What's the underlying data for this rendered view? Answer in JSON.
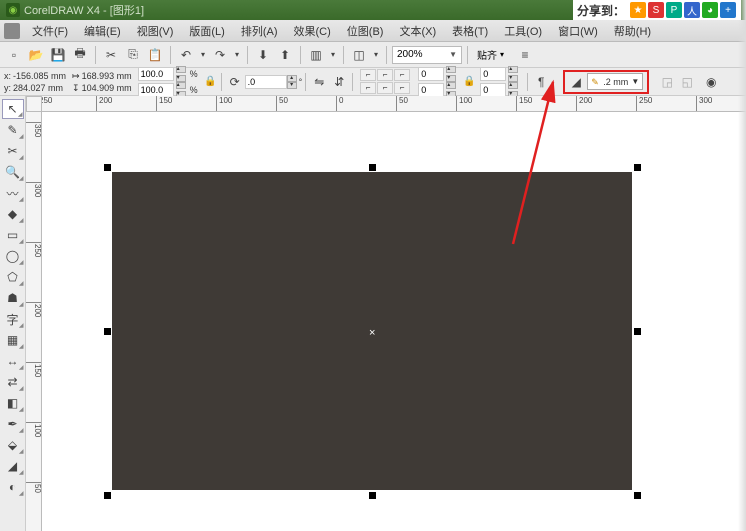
{
  "title": "CorelDRAW X4 - [图形1]",
  "share": {
    "label": "分享到：",
    "icons": [
      "star",
      "weibo",
      "pinterest",
      "renren",
      "wechat",
      "plus"
    ]
  },
  "menu": [
    "文件(F)",
    "编辑(E)",
    "视图(V)",
    "版面(L)",
    "排列(A)",
    "效果(C)",
    "位图(B)",
    "文本(X)",
    "表格(T)",
    "工具(O)",
    "窗口(W)",
    "帮助(H)"
  ],
  "toolbar1": {
    "zoom": "200%",
    "snap_label": "贴齐"
  },
  "propbar": {
    "x_label": "x:",
    "x_val": "-156.085 mm",
    "y_label": "y:",
    "y_val": "284.027 mm",
    "w_val": "168.993 mm",
    "h_val": "104.909 mm",
    "scale_x": "100.0",
    "scale_y": "100.0",
    "scale_unit": "%",
    "rotation": ".0",
    "nudge_a": "0",
    "nudge_b": "0",
    "outline_width": ".2 mm"
  },
  "ruler_h": [
    {
      "pos": 10,
      "label": "250"
    },
    {
      "pos": 70,
      "label": "200"
    },
    {
      "pos": 130,
      "label": "150"
    },
    {
      "pos": 190,
      "label": "100"
    },
    {
      "pos": 250,
      "label": "50"
    },
    {
      "pos": 310,
      "label": "0"
    },
    {
      "pos": 370,
      "label": "50"
    },
    {
      "pos": 430,
      "label": "100"
    },
    {
      "pos": 490,
      "label": "150"
    },
    {
      "pos": 550,
      "label": "200"
    },
    {
      "pos": 610,
      "label": "250"
    },
    {
      "pos": 670,
      "label": "300"
    }
  ],
  "ruler_v": [
    {
      "pos": 10,
      "label": "350"
    },
    {
      "pos": 70,
      "label": "300"
    },
    {
      "pos": 130,
      "label": "250"
    },
    {
      "pos": 190,
      "label": "200"
    },
    {
      "pos": 250,
      "label": "150"
    },
    {
      "pos": 310,
      "label": "100"
    },
    {
      "pos": 370,
      "label": "50"
    }
  ],
  "toolbox": [
    {
      "name": "pick-tool",
      "glyph": "↖",
      "sel": true
    },
    {
      "name": "shape-tool",
      "glyph": "✎"
    },
    {
      "name": "crop-tool",
      "glyph": "✂"
    },
    {
      "name": "zoom-tool",
      "glyph": "🔍"
    },
    {
      "name": "freehand-tool",
      "glyph": "〰"
    },
    {
      "name": "smart-fill-tool",
      "glyph": "◆"
    },
    {
      "name": "rectangle-tool",
      "glyph": "▭"
    },
    {
      "name": "ellipse-tool",
      "glyph": "◯"
    },
    {
      "name": "polygon-tool",
      "glyph": "⬠"
    },
    {
      "name": "basic-shapes-tool",
      "glyph": "☗"
    },
    {
      "name": "text-tool",
      "glyph": "字"
    },
    {
      "name": "table-tool",
      "glyph": "▦"
    },
    {
      "name": "dimension-tool",
      "glyph": "↔"
    },
    {
      "name": "connector-tool",
      "glyph": "⇄"
    },
    {
      "name": "interactive-tool",
      "glyph": "◧"
    },
    {
      "name": "eyedropper-tool",
      "glyph": "✒"
    },
    {
      "name": "outline-tool",
      "glyph": "⬙"
    },
    {
      "name": "fill-tool",
      "glyph": "◢"
    },
    {
      "name": "interactive-fill-tool",
      "glyph": "◐"
    }
  ]
}
